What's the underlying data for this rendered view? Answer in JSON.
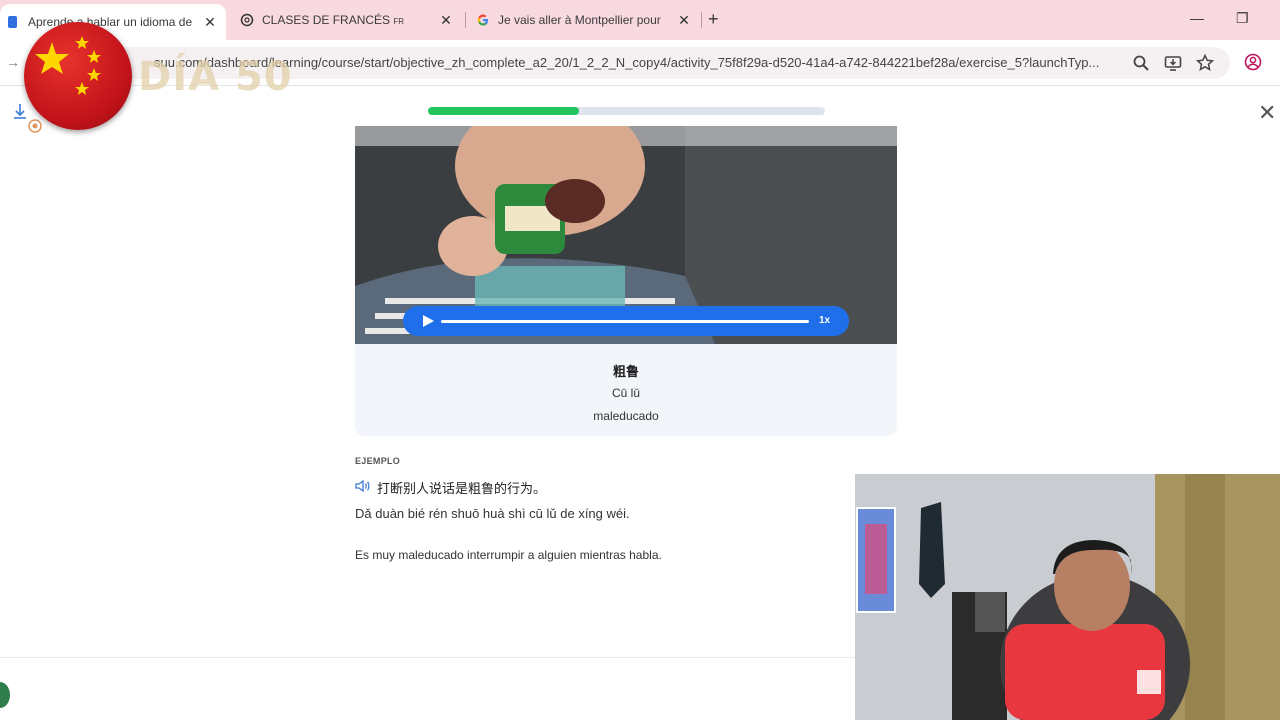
{
  "browser": {
    "tabs": [
      {
        "title": "Aprende a hablar un idioma de",
        "active": true
      },
      {
        "title": "CLASES DE FRANCÉS",
        "suffix": "FR",
        "active": false
      },
      {
        "title": "Je vais aller à Montpellier pour",
        "active": false
      }
    ],
    "url": "suu.com/dashboard/learning/course/start/objective_zh_complete_a2_20/1_2_2_N_copy4/activity_75f8f29a-d520-41a4-a742-844221bef28a/exercise_5?launchTyp..."
  },
  "overlay": {
    "day_text": "DÍA 50"
  },
  "lesson": {
    "progress": 0.38,
    "audio_speed": "1x",
    "word": "粗鲁",
    "pinyin": "Cū lǔ",
    "meaning": "maleducado",
    "example_label": "EJEMPLO",
    "example_cn": "打断别人说话是粗鲁的行为。",
    "example_pinyin": "Dǎ duàn bié rén shuō huà shì cū lǔ de xíng wéi.",
    "example_es": "Es muy maleducado interrumpir a alguien mientras habla."
  },
  "colors": {
    "tabbar": "#f8d9e0",
    "progress": "#22c55e",
    "audio_player": "#1f6feb",
    "card": "#f2f5fa"
  }
}
